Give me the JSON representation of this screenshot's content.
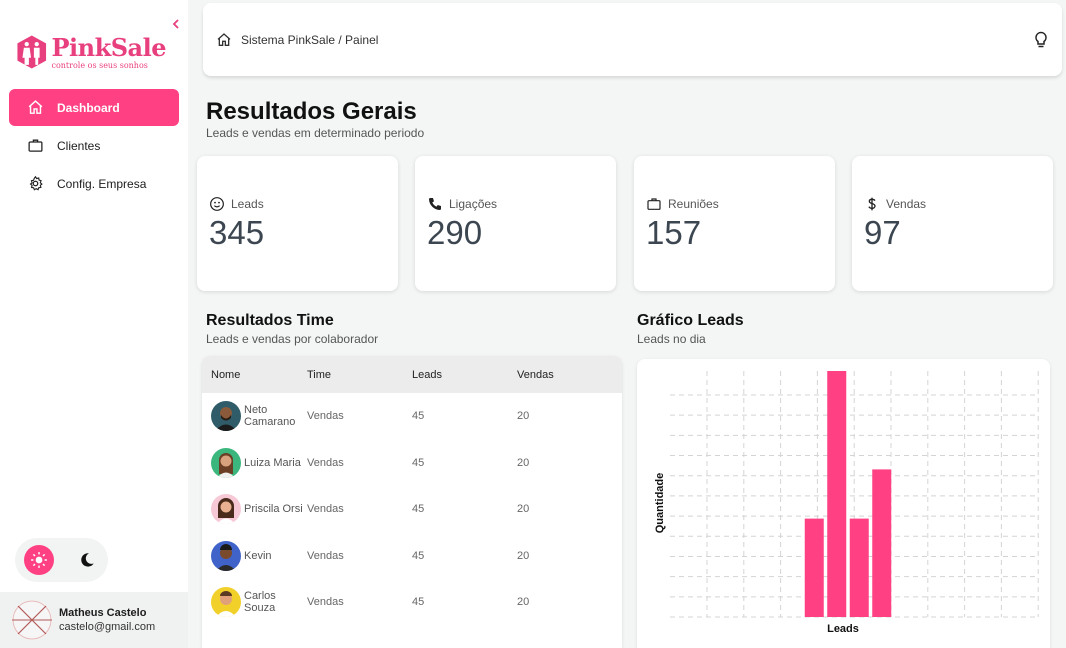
{
  "app": {
    "brand_name": "PinkSale",
    "brand_tagline": "controle os seus sonhos"
  },
  "sidebar": {
    "items": [
      {
        "label": "Dashboard",
        "icon": "home-icon",
        "active": true
      },
      {
        "label": "Clientes",
        "icon": "briefcase-icon",
        "active": false
      },
      {
        "label": "Config. Empresa",
        "icon": "gear-icon",
        "active": false
      }
    ],
    "theme": {
      "selected": "light"
    },
    "user": {
      "name": "Matheus Castelo",
      "email": "castelo@gmail.com"
    }
  },
  "header": {
    "breadcrumb": "Sistema PinkSale / Painel"
  },
  "main": {
    "title": "Resultados Gerais",
    "subtitle": "Leads e vendas em determinado periodo",
    "stats": [
      {
        "label": "Leads",
        "value": "345",
        "icon": "smile-icon"
      },
      {
        "label": "Ligações",
        "value": "290",
        "icon": "phone-icon"
      },
      {
        "label": "Reuniões",
        "value": "157",
        "icon": "briefcase-icon"
      },
      {
        "label": "Vendas",
        "value": "97",
        "icon": "dollar-icon"
      }
    ],
    "team": {
      "title": "Resultados Time",
      "subtitle": "Leads e vendas por colaborador",
      "columns": [
        "Nome",
        "Time",
        "Leads",
        "Vendas"
      ],
      "rows": [
        {
          "name": "Neto Camarano",
          "team": "Vendas",
          "leads": "45",
          "sales": "20"
        },
        {
          "name": "Luiza Maria",
          "team": "Vendas",
          "leads": "45",
          "sales": "20"
        },
        {
          "name": "Priscila Orsi",
          "team": "Vendas",
          "leads": "45",
          "sales": "20"
        },
        {
          "name": "Kevin",
          "team": "Vendas",
          "leads": "45",
          "sales": "20"
        },
        {
          "name": "Carlos Souza",
          "team": "Vendas",
          "leads": "45",
          "sales": "20"
        }
      ]
    },
    "chart": {
      "title": "Gráfico Leads",
      "subtitle": "Leads no dia"
    }
  },
  "colors": {
    "accent": "#ff4183",
    "brand": "#e8407e"
  },
  "chart_data": {
    "type": "bar",
    "title": "",
    "xlabel": "Leads",
    "ylabel": "Quantidade",
    "grid": true,
    "legend": "none",
    "ylim": [
      0,
      10
    ],
    "series": [
      {
        "values": [
          4,
          10,
          4,
          6
        ]
      }
    ]
  }
}
